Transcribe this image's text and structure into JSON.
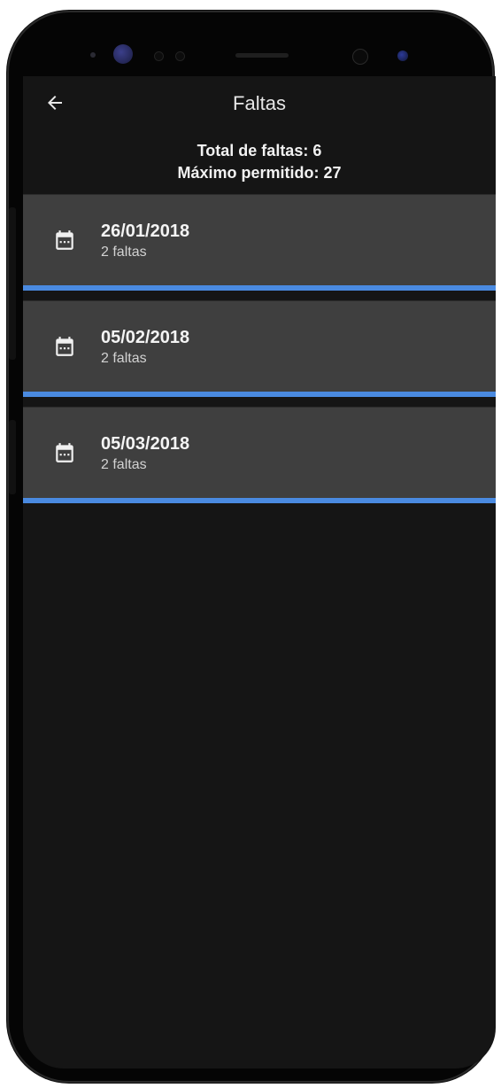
{
  "appbar": {
    "title": "Faltas",
    "back_icon": "arrow-left-icon"
  },
  "summary": {
    "total": "Total de faltas: 6",
    "maximum": "Máximo permitido: 27"
  },
  "items": [
    {
      "date": "26/01/2018",
      "count": "2 faltas",
      "icon": "calendar-icon"
    },
    {
      "date": "05/02/2018",
      "count": "2 faltas",
      "icon": "calendar-icon"
    },
    {
      "date": "05/03/2018",
      "count": "2 faltas",
      "icon": "calendar-icon"
    }
  ],
  "colors": {
    "background": "#151515",
    "item_background": "#3f3f3f",
    "accent": "#4a8ae0",
    "text_primary": "#f4f4f4",
    "text_secondary": "#d2d2d2"
  }
}
